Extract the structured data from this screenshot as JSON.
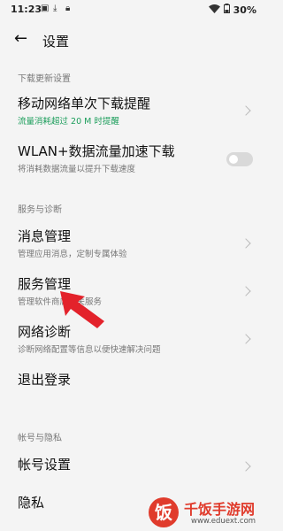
{
  "status": {
    "time": "11:23",
    "battery": "30%"
  },
  "header": {
    "title": "设置"
  },
  "sections": [
    {
      "label": "下载更新设置"
    },
    {
      "label": "服务与诊断"
    },
    {
      "label": "帐号与隐私"
    }
  ],
  "items": {
    "mobile_download": {
      "title": "移动网络单次下载提醒",
      "subtitle": "流量消耗超过 20 M 时提醒"
    },
    "wlan_boost": {
      "title": "WLAN+数据流量加速下载",
      "subtitle": "将消耗数据流量以提升下载速度",
      "enabled": false
    },
    "message_mgmt": {
      "title": "消息管理",
      "subtitle": "管理应用消息，定制专属体验"
    },
    "service_mgmt": {
      "title": "服务管理",
      "subtitle": "管理软件商店相关服务"
    },
    "network_diag": {
      "title": "网络诊断",
      "subtitle": "诊断网络配置等信息以便快速解决问题"
    },
    "logout": {
      "title": "退出登录"
    },
    "account": {
      "title": "帐号设置"
    },
    "privacy": {
      "title": "隐私"
    }
  },
  "watermark": {
    "logo_char": "饭",
    "name": "千饭手游网",
    "url": "www.eduext.com"
  },
  "colors": {
    "accent_green": "#1d9e5c",
    "arrow_red": "#e3222b",
    "watermark_red": "#e03b2c"
  }
}
